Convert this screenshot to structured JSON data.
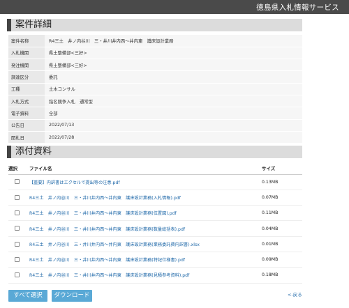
{
  "header": {
    "service_name": "徳島県入札情報サービス"
  },
  "detail_section": {
    "title": "案件詳細",
    "rows": [
      {
        "label": "案件名称",
        "value": "R4三土　井ノ内谷川　三・井川井内西〜井内東　護床設計業務"
      },
      {
        "label": "入札機関",
        "value": "県土整備部<三好>"
      },
      {
        "label": "発注機関",
        "value": "県土整備部<三好>"
      },
      {
        "label": "調達区分",
        "value": "委託"
      },
      {
        "label": "工種",
        "value": "土木コンサル"
      },
      {
        "label": "入札方式",
        "value": "指名競争入札　通常型"
      },
      {
        "label": "電子資料",
        "value": "全部"
      },
      {
        "label": "公告日",
        "value": "2022/07/13"
      },
      {
        "label": "開札日",
        "value": "2022/07/28"
      }
    ]
  },
  "attach_section": {
    "title": "添付資料",
    "columns": {
      "select": "選択",
      "file_name": "ファイル名",
      "size": "サイズ"
    },
    "files": [
      {
        "name": "【重要】内訳書はエクセルで提出等の注意.pdf",
        "size": "0.13MB"
      },
      {
        "name": "R4三土　井ノ内谷川　三・井川井内西〜井内東　護床設計業務(入札情報).pdf",
        "size": "0.07MB"
      },
      {
        "name": "R4三土　井ノ内谷川　三・井川井内西〜井内東　護床設計業務(位置図).pdf",
        "size": "0.11MB"
      },
      {
        "name": "R4三土　井ノ内谷川　三・井川井内西〜井内東　護床設計業務(数量総括表).pdf",
        "size": "0.04MB"
      },
      {
        "name": "R4三土　井ノ内谷川　三・井川井内西〜井内東　護床設計業務(業務委託費内訳書).xlsx",
        "size": "0.01MB"
      },
      {
        "name": "R4三土　井ノ内谷川　三・井川井内西〜井内東　護床設計業務(特記仕様書).pdf",
        "size": "0.09MB"
      },
      {
        "name": "R4三土　井ノ内谷川　三・井川井内西〜井内東　護床設計業務(見積参考資料).pdf",
        "size": "0.18MB"
      }
    ]
  },
  "actions": {
    "select_all": "すべて選択",
    "download": "ダウンロード",
    "back": "<-戻る"
  },
  "colors": {
    "topbar": "#4a4a4a",
    "button": "#5aa9d6",
    "link": "#1d67a8"
  }
}
